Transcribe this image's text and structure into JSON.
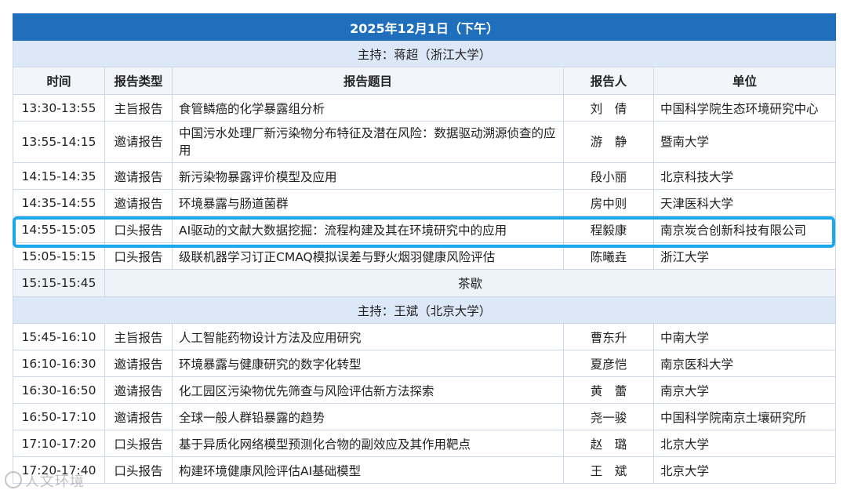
{
  "title": "2025年12月1日（下午）",
  "session1_host": "主持：蒋超（浙江大学）",
  "session2_host": "主持：王斌（北京大学）",
  "headers": {
    "time": "时间",
    "type": "报告类型",
    "topic": "报告题目",
    "speaker": "报告人",
    "unit": "单位"
  },
  "session1_rows": [
    {
      "time": "13:30-13:55",
      "type": "主旨报告",
      "topic": "食管鳞癌的化学暴露组分析",
      "speaker": "刘　倩",
      "unit": "中国科学院生态环境研究中心"
    },
    {
      "time": "13:55-14:15",
      "type": "邀请报告",
      "topic": "中国污水处理厂新污染物分布特征及潜在风险：数据驱动溯源侦查的应用",
      "speaker": "游　静",
      "unit": "暨南大学"
    },
    {
      "time": "14:15-14:35",
      "type": "邀请报告",
      "topic": "新污染物暴露评价模型及应用",
      "speaker": "段小丽",
      "unit": "北京科技大学"
    },
    {
      "time": "14:35-14:55",
      "type": "邀请报告",
      "topic": "环境暴露与肠道菌群",
      "speaker": "房中则",
      "unit": "天津医科大学"
    },
    {
      "time": "14:55-15:05",
      "type": "口头报告",
      "topic": "AI驱动的文献大数据挖掘：流程构建及其在环境研究中的应用",
      "speaker": "程毅康",
      "unit": "南京炭合创新科技有限公司"
    },
    {
      "time": "15:05-15:15",
      "type": "口头报告",
      "topic": "级联机器学习订正CMAQ模拟误差与野火烟羽健康风险评估",
      "speaker": "陈曦垚",
      "unit": "浙江大学"
    }
  ],
  "break_row": {
    "time": "15:15-15:45",
    "label": "茶歇"
  },
  "session2_rows": [
    {
      "time": "15:45-16:10",
      "type": "主旨报告",
      "topic": "人工智能药物设计方法及应用研究",
      "speaker": "曹东升",
      "unit": "中南大学"
    },
    {
      "time": "16:10-16:30",
      "type": "邀请报告",
      "topic": "环境暴露与健康研究的数字化转型",
      "speaker": "夏彦恺",
      "unit": "南京医科大学"
    },
    {
      "time": "16:30-16:50",
      "type": "邀请报告",
      "topic": "化工园区污染物优先筛查与风险评估新方法探索",
      "speaker": "黄　蕾",
      "unit": "南京大学"
    },
    {
      "time": "16:50-17:10",
      "type": "邀请报告",
      "topic": "全球一般人群铅暴露的趋势",
      "speaker": "尧一骏",
      "unit": "中国科学院南京土壤研究所"
    },
    {
      "time": "17:10-17:20",
      "type": "口头报告",
      "topic": "基于异质化网络模型预测化合物的副效应及其作用靶点",
      "speaker": "赵　璐",
      "unit": "北京大学"
    },
    {
      "time": "17:20-17:40",
      "type": "口头报告",
      "topic": "构建环境健康风险评估AI基础模型",
      "speaker": "王　斌",
      "unit": "北京大学"
    }
  ],
  "watermark": "人文环境"
}
